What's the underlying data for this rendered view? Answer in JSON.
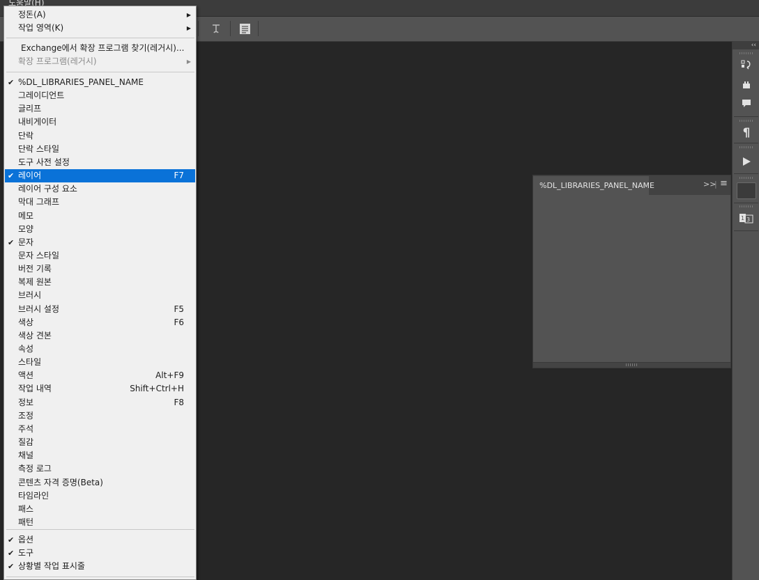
{
  "menubar": {
    "help_label": "도움말(H)"
  },
  "right_toolbar": {
    "collapse_label": "‹‹",
    "icons": [
      "history-icon",
      "brush-stamp-icon",
      "comment-icon",
      "paragraph-icon",
      "play-icon",
      "swatch-icon",
      "3d-layers-icon"
    ]
  },
  "libraries_panel": {
    "tab_label": "%DL_LIBRARIES_PANEL_NAME",
    "expand_label": ">>",
    "menu_label": "≡"
  },
  "menu": {
    "top_items": [
      {
        "label": "정돈(A)",
        "submenu": true
      },
      {
        "label": "작업 영역(K)",
        "submenu": true
      }
    ],
    "extension_items": [
      {
        "label": "Exchange에서 확장 프로그램 찾기(레거시)...",
        "disabled": false,
        "submenu": false
      },
      {
        "label": "확장 프로그램(레거시)",
        "disabled": true,
        "submenu": true
      }
    ],
    "panel_items": [
      {
        "label": "%DL_LIBRARIES_PANEL_NAME",
        "checked": true,
        "shortcut": ""
      },
      {
        "label": "그레이디언트",
        "checked": false,
        "shortcut": ""
      },
      {
        "label": "글리프",
        "checked": false,
        "shortcut": ""
      },
      {
        "label": "내비게이터",
        "checked": false,
        "shortcut": ""
      },
      {
        "label": "단락",
        "checked": false,
        "shortcut": ""
      },
      {
        "label": "단락 스타일",
        "checked": false,
        "shortcut": ""
      },
      {
        "label": "도구 사전 설정",
        "checked": false,
        "shortcut": ""
      },
      {
        "label": "레이어",
        "checked": true,
        "shortcut": "F7",
        "highlighted": true
      },
      {
        "label": "레이어 구성 요소",
        "checked": false,
        "shortcut": ""
      },
      {
        "label": "막대 그래프",
        "checked": false,
        "shortcut": ""
      },
      {
        "label": "메모",
        "checked": false,
        "shortcut": ""
      },
      {
        "label": "모양",
        "checked": false,
        "shortcut": ""
      },
      {
        "label": "문자",
        "checked": true,
        "shortcut": ""
      },
      {
        "label": "문자 스타일",
        "checked": false,
        "shortcut": ""
      },
      {
        "label": "버전 기록",
        "checked": false,
        "shortcut": ""
      },
      {
        "label": "복제 원본",
        "checked": false,
        "shortcut": ""
      },
      {
        "label": "브러시",
        "checked": false,
        "shortcut": ""
      },
      {
        "label": "브러시 설정",
        "checked": false,
        "shortcut": "F5"
      },
      {
        "label": "색상",
        "checked": false,
        "shortcut": "F6"
      },
      {
        "label": "색상 견본",
        "checked": false,
        "shortcut": ""
      },
      {
        "label": "속성",
        "checked": false,
        "shortcut": ""
      },
      {
        "label": "스타일",
        "checked": false,
        "shortcut": ""
      },
      {
        "label": "액션",
        "checked": false,
        "shortcut": "Alt+F9"
      },
      {
        "label": "작업 내역",
        "checked": false,
        "shortcut": "Shift+Ctrl+H"
      },
      {
        "label": "정보",
        "checked": false,
        "shortcut": "F8"
      },
      {
        "label": "조정",
        "checked": false,
        "shortcut": ""
      },
      {
        "label": "주석",
        "checked": false,
        "shortcut": ""
      },
      {
        "label": "질감",
        "checked": false,
        "shortcut": ""
      },
      {
        "label": "채널",
        "checked": false,
        "shortcut": ""
      },
      {
        "label": "측정 로그",
        "checked": false,
        "shortcut": ""
      },
      {
        "label": "콘텐츠 자격 증명(Beta)",
        "checked": false,
        "shortcut": ""
      },
      {
        "label": "타임라인",
        "checked": false,
        "shortcut": ""
      },
      {
        "label": "패스",
        "checked": false,
        "shortcut": ""
      },
      {
        "label": "패턴",
        "checked": false,
        "shortcut": ""
      }
    ],
    "bottom_items": [
      {
        "label": "옵션",
        "checked": true
      },
      {
        "label": "도구",
        "checked": true
      },
      {
        "label": "상황별 작업 표시줄",
        "checked": true
      }
    ],
    "check_mark": "✔",
    "arrow_mark": "▶"
  },
  "colors": {
    "highlight": "#0a72d8",
    "menu_bg": "#f0f0f0",
    "canvas_bg": "#262626"
  }
}
